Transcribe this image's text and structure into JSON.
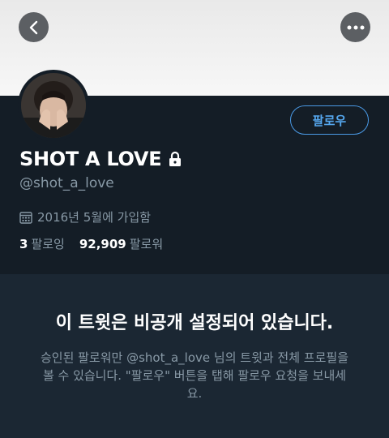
{
  "header": {
    "back_icon": "chevron-left-icon",
    "more_icon": "more-dots-icon"
  },
  "profile": {
    "display_name": "SHOT A LOVE",
    "handle": "@shot_a_love",
    "joined": "2016년 5월에 가입함",
    "following_count": "3",
    "following_label": "팔로잉",
    "followers_count": "92,909",
    "followers_label": "팔로워",
    "follow_button": "팔로우"
  },
  "protected_notice": {
    "title": "이 트윗은 비공개 설정되어 있습니다.",
    "description": "승인된 팔로워만 @shot_a_love 님의 트윗과 전체 프로필을 볼 수 있습니다. \"팔로우\" 버튼을 탭해 팔로우 요청을 보내세요."
  },
  "colors": {
    "accent": "#55a7ee",
    "background": "#141d26",
    "muted": "#8899a6"
  }
}
